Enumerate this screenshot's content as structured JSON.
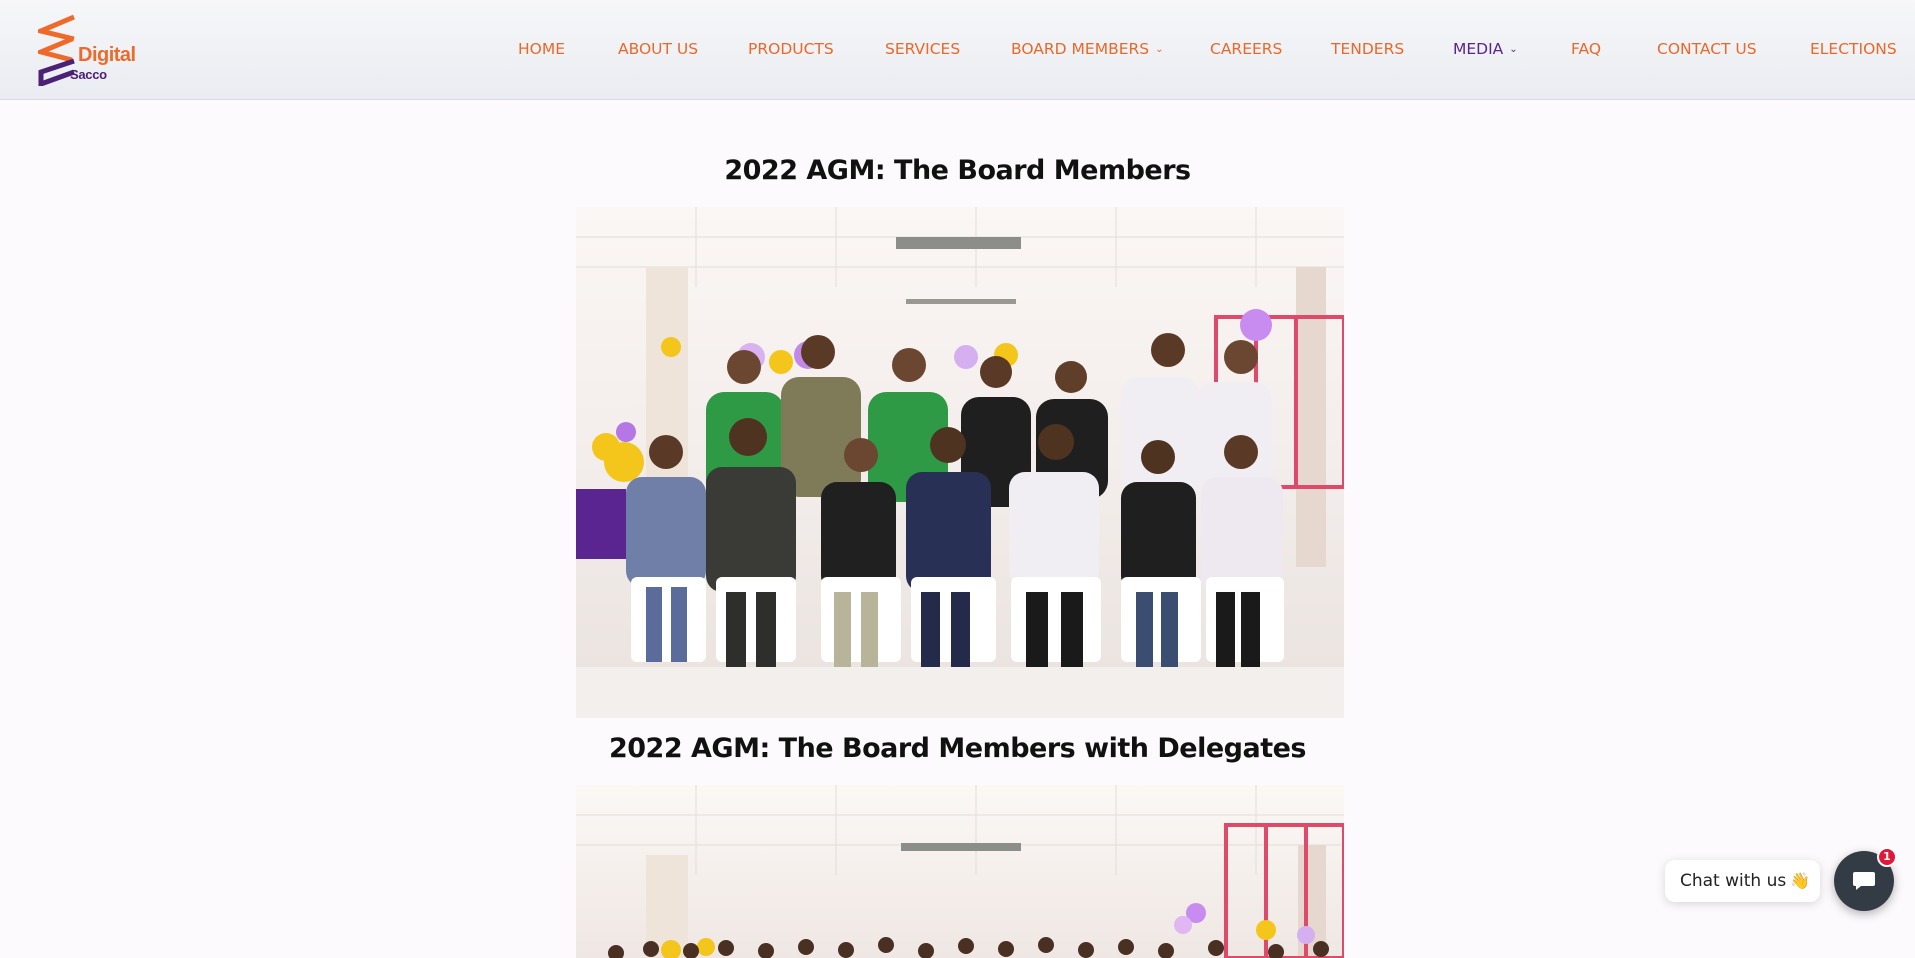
{
  "logo": {
    "word1": "Digital",
    "word2": "Sacco"
  },
  "nav": {
    "items": [
      {
        "label": "HOME"
      },
      {
        "label": "ABOUT US"
      },
      {
        "label": "PRODUCTS"
      },
      {
        "label": "SERVICES"
      },
      {
        "label": "BOARD MEMBERS",
        "has_dropdown": true
      },
      {
        "label": "CAREERS"
      },
      {
        "label": "TENDERS"
      },
      {
        "label": "MEDIA",
        "has_dropdown": true,
        "active": true
      },
      {
        "label": "FAQ"
      },
      {
        "label": "CONTACT US"
      },
      {
        "label": "ELECTIONS"
      }
    ],
    "chevron": "⌄"
  },
  "gallery": [
    {
      "heading": "2022 AGM: The Board Members"
    },
    {
      "heading": "2022 AGM: The Board Members with Delegates"
    }
  ],
  "chat": {
    "label": "Chat with us",
    "emoji": "👋",
    "badge": "1"
  },
  "colors": {
    "nav_text": "#e8692a",
    "nav_active": "#5b2591",
    "chat_button": "#333c45",
    "badge": "#e0193a"
  }
}
